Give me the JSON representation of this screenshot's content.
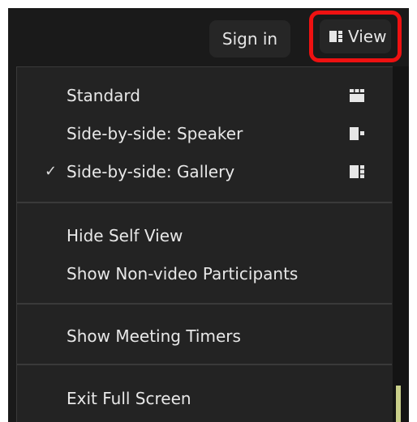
{
  "topbar": {
    "signin_label": "Sign in",
    "view_label": "View",
    "view_icon": "view-layout-icon",
    "highlight_color": "#ee1111"
  },
  "menu": {
    "layouts": [
      {
        "label": "Standard",
        "icon": "grid-icon",
        "checked": false
      },
      {
        "label": "Side-by-side: Speaker",
        "icon": "speaker-layout-icon",
        "checked": false
      },
      {
        "label": "Side-by-side: Gallery",
        "icon": "gallery-layout-icon",
        "checked": true
      }
    ],
    "check_mark": "✓",
    "view_options": [
      {
        "label": "Hide Self View"
      },
      {
        "label": "Show Non-video Participants"
      }
    ],
    "timers": [
      {
        "label": "Show Meeting Timers"
      }
    ],
    "screen": [
      {
        "label": "Exit Full Screen"
      }
    ]
  }
}
